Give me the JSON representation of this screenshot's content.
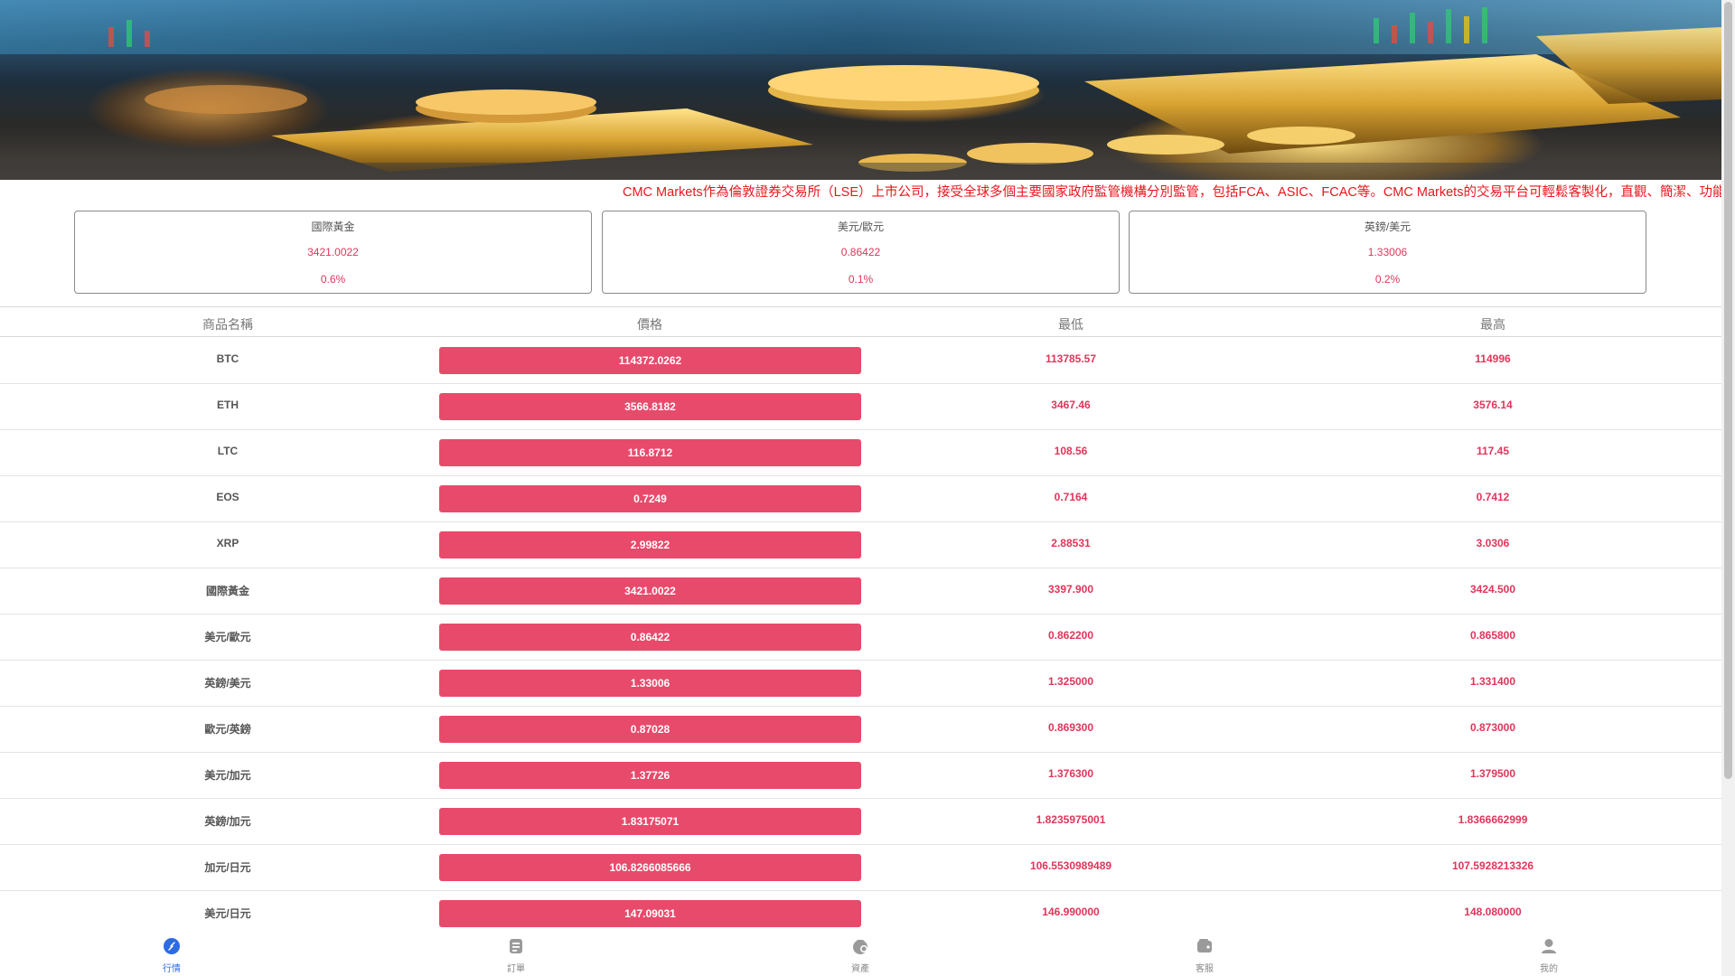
{
  "marquee": {
    "text": "CMC Markets作為倫敦證券交易所（LSE）上市公司，接受全球多個主要國家政府監管機構分別監管，包括FCA、ASIC、FCAC等。CMC Markets的交易平台可輕鬆客製化，直觀、簡潔、功能強大。"
  },
  "cards": [
    {
      "name": "國際黃金",
      "price": "3421.0022",
      "change": "0.6%"
    },
    {
      "name": "美元/歐元",
      "price": "0.86422",
      "change": "0.1%"
    },
    {
      "name": "英鎊/美元",
      "price": "1.33006",
      "change": "0.2%"
    }
  ],
  "table": {
    "headers": {
      "name": "商品名稱",
      "price": "價格",
      "low": "最低",
      "high": "最高"
    },
    "rows": [
      {
        "name": "BTC",
        "price": "114372.0262",
        "low": "113785.57",
        "high": "114996"
      },
      {
        "name": "ETH",
        "price": "3566.8182",
        "low": "3467.46",
        "high": "3576.14"
      },
      {
        "name": "LTC",
        "price": "116.8712",
        "low": "108.56",
        "high": "117.45"
      },
      {
        "name": "EOS",
        "price": "0.7249",
        "low": "0.7164",
        "high": "0.7412"
      },
      {
        "name": "XRP",
        "price": "2.99822",
        "low": "2.88531",
        "high": "3.0306"
      },
      {
        "name": "國際黃金",
        "price": "3421.0022",
        "low": "3397.900",
        "high": "3424.500"
      },
      {
        "name": "美元/歐元",
        "price": "0.86422",
        "low": "0.862200",
        "high": "0.865800"
      },
      {
        "name": "英鎊/美元",
        "price": "1.33006",
        "low": "1.325000",
        "high": "1.331400"
      },
      {
        "name": "歐元/英鎊",
        "price": "0.87028",
        "low": "0.869300",
        "high": "0.873000"
      },
      {
        "name": "美元/加元",
        "price": "1.37726",
        "low": "1.376300",
        "high": "1.379500"
      },
      {
        "name": "英鎊/加元",
        "price": "1.83175071",
        "low": "1.8235975001",
        "high": "1.8366662999"
      },
      {
        "name": "加元/日元",
        "price": "106.8266085666",
        "low": "106.5530989489",
        "high": "107.5928213326"
      },
      {
        "name": "美元/日元",
        "price": "147.09031",
        "low": "146.990000",
        "high": "148.080000"
      }
    ]
  },
  "nav": [
    {
      "label": "行情",
      "icon": "market-icon",
      "active": true
    },
    {
      "label": "訂單",
      "icon": "orders-icon",
      "active": false
    },
    {
      "label": "資產",
      "icon": "assets-icon",
      "active": false
    },
    {
      "label": "客服",
      "icon": "support-icon",
      "active": false
    },
    {
      "label": "我的",
      "icon": "profile-icon",
      "active": false
    }
  ],
  "colors": {
    "accent": "#e84a6b",
    "price_text": "#e0355a",
    "marquee_text": "#e8161c",
    "nav_active": "#2d6be4",
    "nav_inactive": "#888888"
  }
}
